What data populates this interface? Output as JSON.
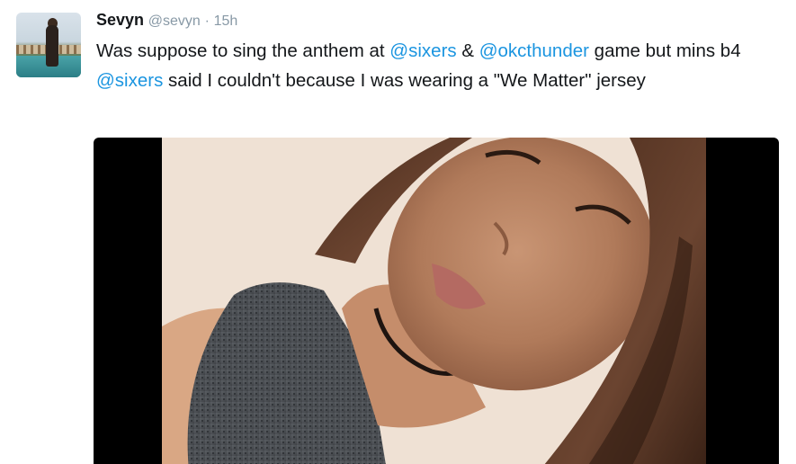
{
  "tweet": {
    "author_name": "Sevyn",
    "author_handle": "@sevyn",
    "separator": "·",
    "timestamp": "15h",
    "text_parts": {
      "p1": "Was suppose to sing the anthem at ",
      "m1": "@sixers",
      "p2": " & ",
      "m2": "@okcthunder",
      "p3": " game but mins b4 ",
      "m3": "@sixers",
      "p4": " said I couldn't because I was wearing a \"We Matter\" jersey"
    }
  },
  "colors": {
    "text": "#14171a",
    "secondary": "#8899a6",
    "mention": "#1b95e0",
    "media_bg": "#000000"
  },
  "icons": {
    "avatar": "profile-photo"
  }
}
